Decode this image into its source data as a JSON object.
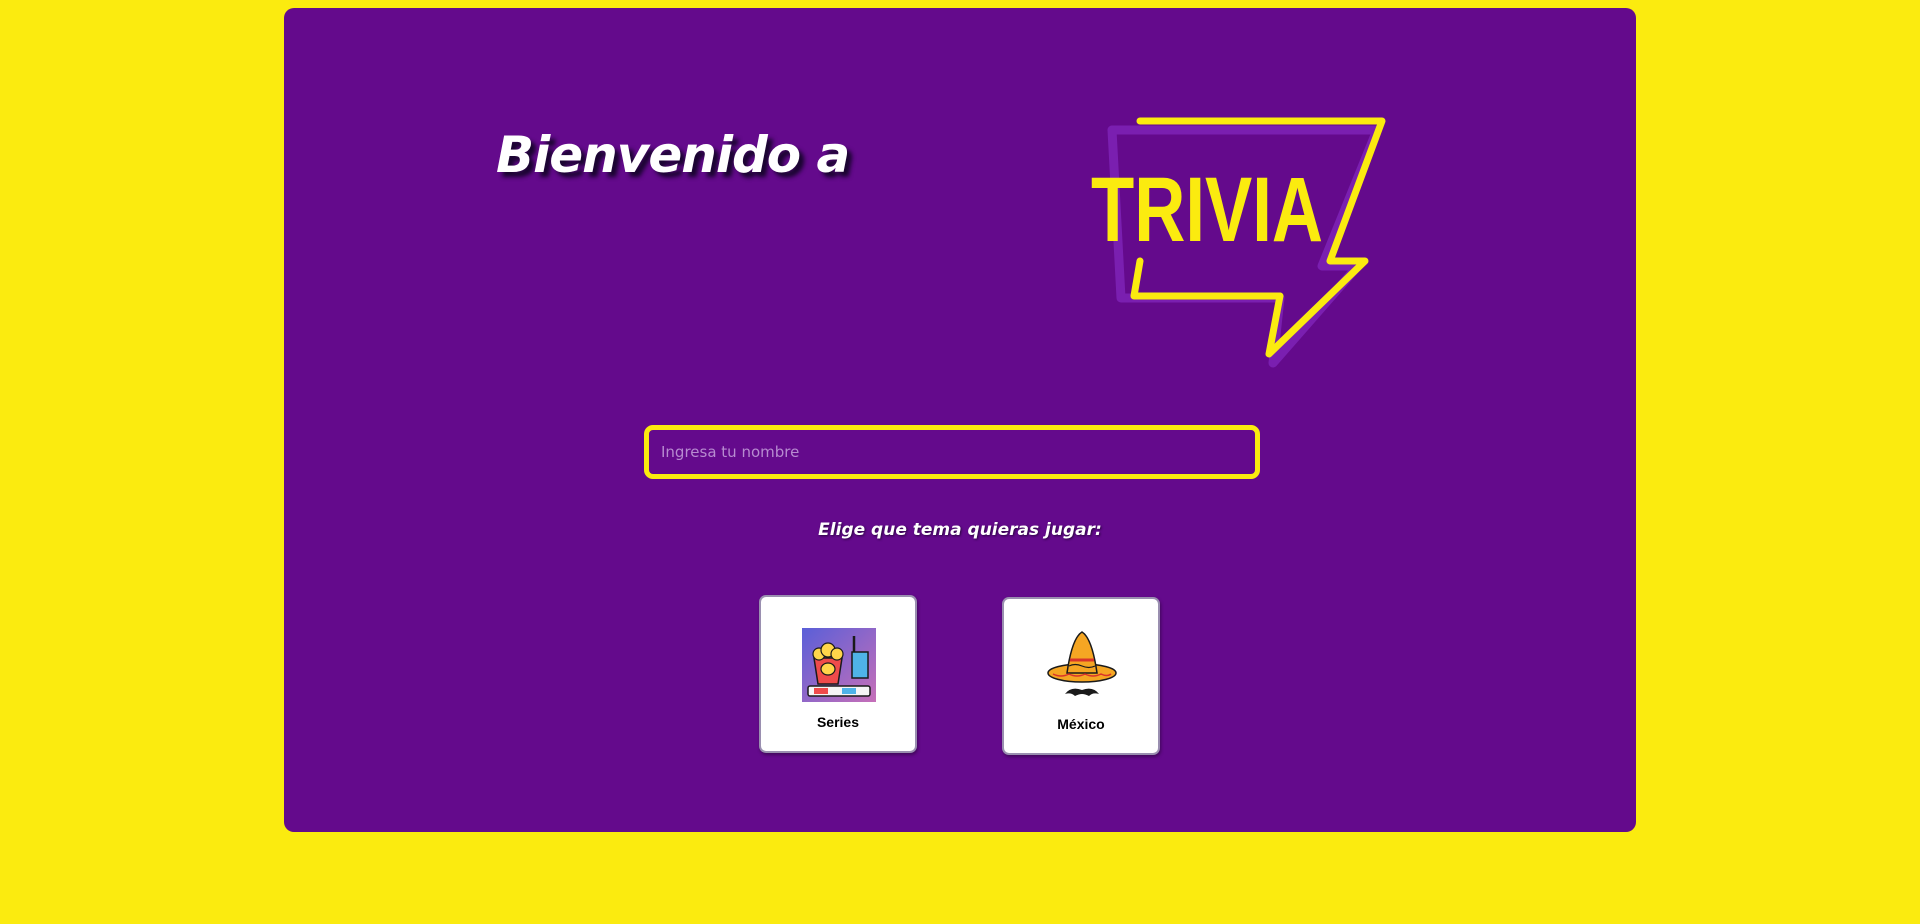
{
  "header": {
    "welcome_text": "Bienvenido a",
    "logo_text": "TRIVIA"
  },
  "form": {
    "name_placeholder": "Ingresa tu nombre",
    "name_value": ""
  },
  "topics": {
    "prompt": "Elige que tema quieras jugar:",
    "items": [
      {
        "label": "Series",
        "icon": "popcorn-cinema-icon"
      },
      {
        "label": "México",
        "icon": "sombrero-mustache-icon"
      }
    ]
  },
  "colors": {
    "background": "#FBEB0F",
    "panel": "#640A8C",
    "accent": "#FBEB0F"
  }
}
